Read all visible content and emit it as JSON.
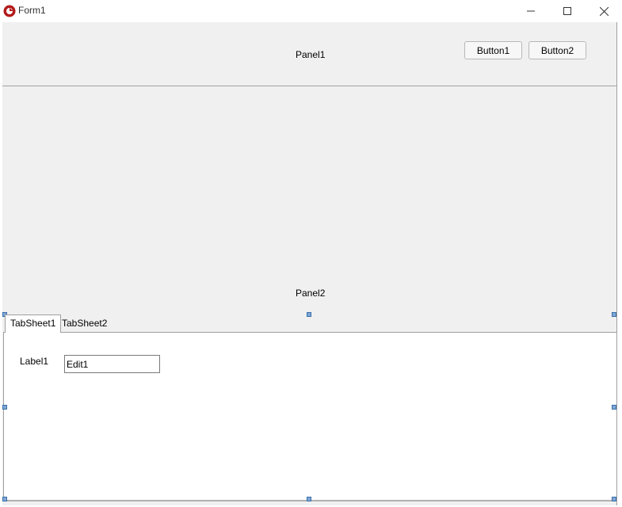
{
  "window": {
    "title": "Form1",
    "icon": "app-logo-icon",
    "controls": [
      "minimize-icon",
      "maximize-icon",
      "close-icon"
    ]
  },
  "panel1": {
    "caption": "Panel1",
    "buttons": [
      {
        "label": "Button1"
      },
      {
        "label": "Button2"
      }
    ]
  },
  "panel2": {
    "caption": "Panel2"
  },
  "pagecontrol": {
    "tabs": [
      {
        "label": "TabSheet1",
        "active": true
      },
      {
        "label": "TabSheet2",
        "active": false
      }
    ],
    "page": {
      "label": "Label1",
      "edit_value": "Edit1"
    }
  },
  "colors": {
    "form_bg": "#f0f0f0",
    "selection_handle": "#7fa7d8"
  }
}
